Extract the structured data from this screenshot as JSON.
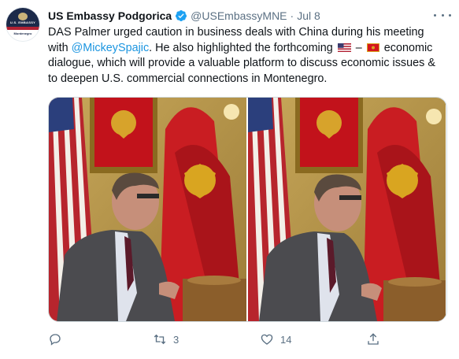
{
  "account": {
    "name": "US Embassy Podgorica",
    "handle": "@USEmbassyMNE",
    "separator": "·",
    "date": "Jul 8",
    "avatar_text_top": "U.S. EMBASSY",
    "avatar_text_bottom": "Montenegro"
  },
  "tweet": {
    "text_part1": "DAS Palmer urged caution in business deals with China during his meeting with ",
    "mention": "@MickeySpajic",
    "text_part2": ". He also highlighted the forthcoming ",
    "dash": " – ",
    "text_part3": " economic dialogue, which will provide a valuable platform to discuss economic issues & to deepen U.S. commercial connections in Montenegro."
  },
  "actions": {
    "reply_count": "",
    "retweet_count": "3",
    "like_count": "14",
    "share_count": ""
  },
  "colors": {
    "link": "#1b95e0",
    "muted": "#5b7083",
    "verified": "#1da1f2",
    "flag_red": "#d4161c",
    "flag_gold": "#d9a520"
  },
  "icons": [
    "verified-icon",
    "more-icon",
    "reply-icon",
    "retweet-icon",
    "like-icon",
    "share-icon",
    "us-flag-icon",
    "montenegro-flag-icon"
  ]
}
